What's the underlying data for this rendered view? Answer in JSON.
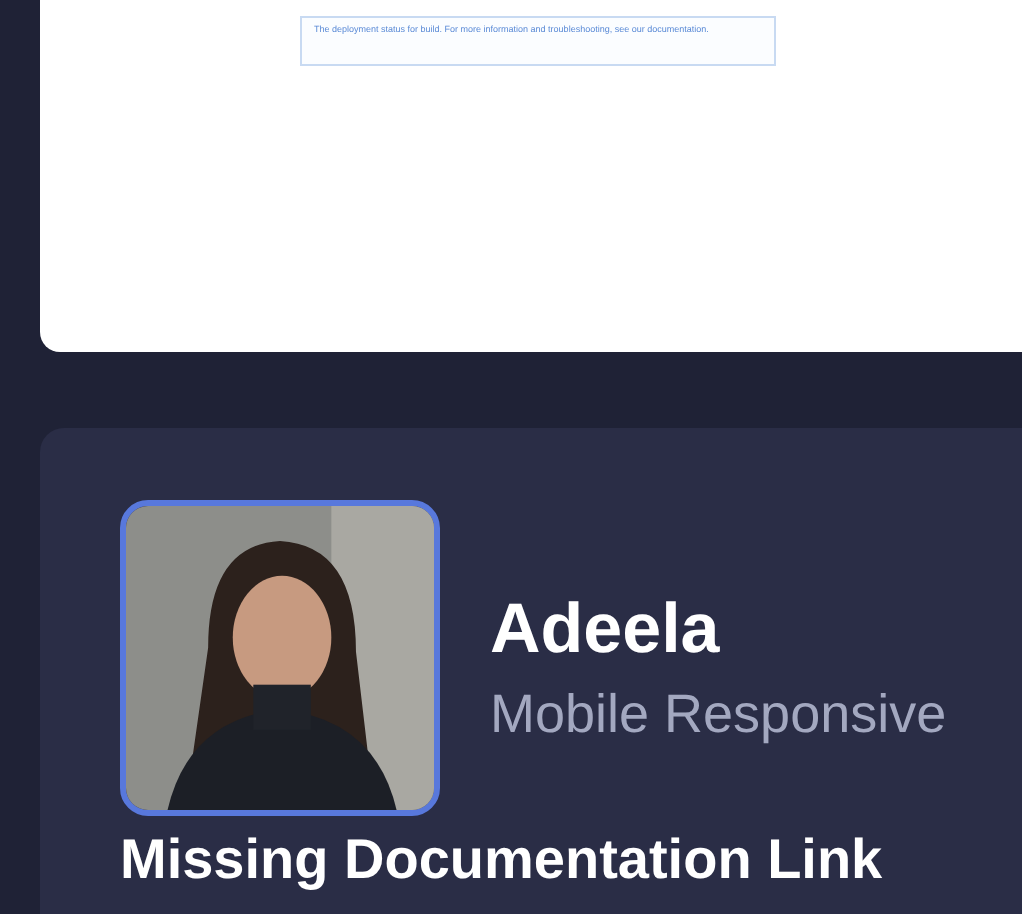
{
  "notice": {
    "text": "The deployment status for build. For more information and troubleshooting, see our documentation."
  },
  "profile": {
    "name": "Adeela",
    "role": "Mobile Responsive",
    "heading": "Missing Documentation Link"
  }
}
